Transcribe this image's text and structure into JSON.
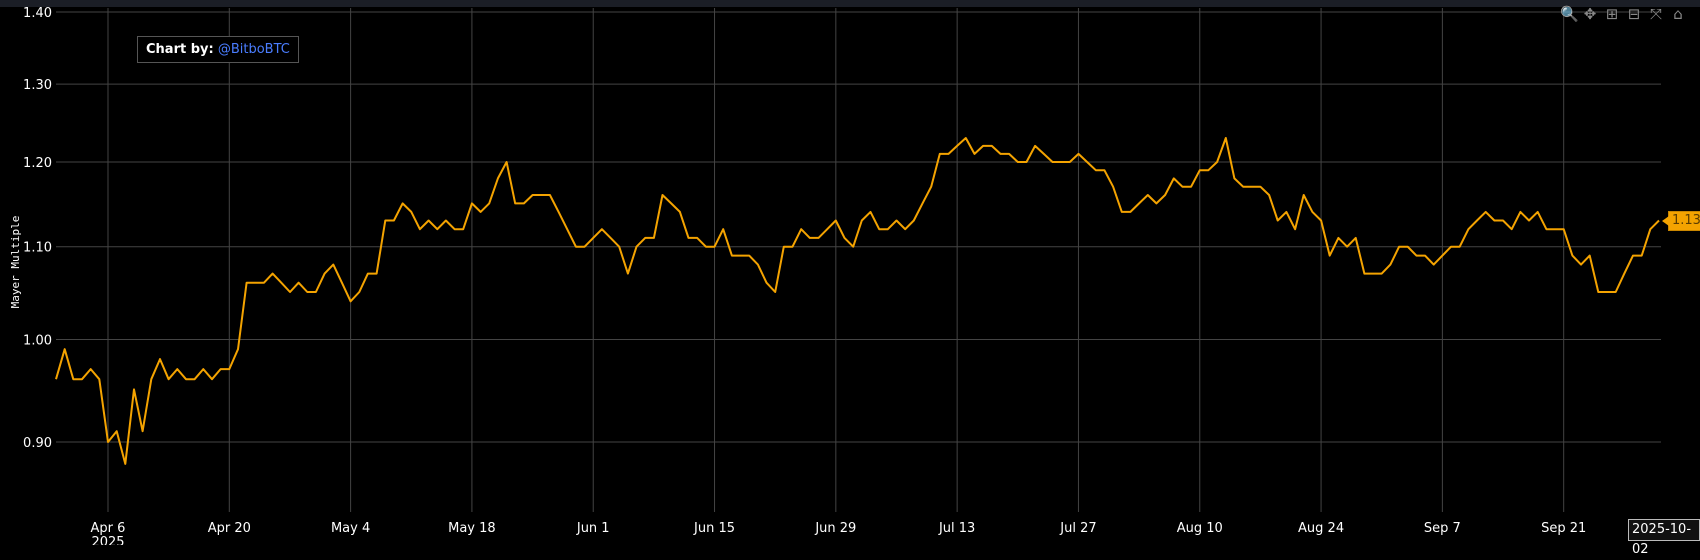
{
  "credit": {
    "label": "Chart by:",
    "handle": "@BitboBTC"
  },
  "modebar": [
    {
      "name": "zoom-icon",
      "glyph": "🔍"
    },
    {
      "name": "pan-icon",
      "glyph": "✥"
    },
    {
      "name": "zoom-in-icon",
      "glyph": "⊞"
    },
    {
      "name": "zoom-out-icon",
      "glyph": "⊟"
    },
    {
      "name": "autoscale-icon",
      "glyph": "⤧"
    },
    {
      "name": "reset-axes-icon",
      "glyph": "⌂"
    }
  ],
  "last_value_label": "1.13",
  "hover_date_label": "2025-10-02",
  "colors": {
    "line": "#f4a300",
    "grid": "#444444",
    "background": "#000000"
  },
  "chart_data": {
    "type": "line",
    "title": "",
    "xlabel": "",
    "ylabel": "Mayer Multiple",
    "y_scale": "log",
    "ylim": [
      0.855,
      1.4
    ],
    "yticks": [
      0.9,
      1.0,
      1.1,
      1.2,
      1.3,
      1.4
    ],
    "ytick_labels": [
      "0.90",
      "1.00",
      "1.10",
      "1.20",
      "1.30",
      "1.40"
    ],
    "x_start": "2025-03-31",
    "x_end": "2025-10-02",
    "x_step": "1 day",
    "xticks": [
      {
        "date": "2025-04-06",
        "label": "Apr 6",
        "sublabel": "2025"
      },
      {
        "date": "2025-04-20",
        "label": "Apr 20"
      },
      {
        "date": "2025-05-04",
        "label": "May 4"
      },
      {
        "date": "2025-05-18",
        "label": "May 18"
      },
      {
        "date": "2025-06-01",
        "label": "Jun 1"
      },
      {
        "date": "2025-06-15",
        "label": "Jun 15"
      },
      {
        "date": "2025-06-29",
        "label": "Jun 29"
      },
      {
        "date": "2025-07-13",
        "label": "Jul 13"
      },
      {
        "date": "2025-07-27",
        "label": "Jul 27"
      },
      {
        "date": "2025-08-10",
        "label": "Aug 10"
      },
      {
        "date": "2025-08-24",
        "label": "Aug 24"
      },
      {
        "date": "2025-09-07",
        "label": "Sep 7"
      },
      {
        "date": "2025-09-21",
        "label": "Sep 21"
      }
    ],
    "grid": true,
    "series": [
      {
        "name": "Mayer Multiple",
        "values": [
          0.96,
          0.99,
          0.96,
          0.96,
          0.97,
          0.96,
          0.9,
          0.91,
          0.88,
          0.95,
          0.91,
          0.96,
          0.98,
          0.96,
          0.97,
          0.96,
          0.96,
          0.97,
          0.96,
          0.97,
          0.97,
          0.99,
          1.06,
          1.06,
          1.06,
          1.07,
          1.06,
          1.05,
          1.06,
          1.05,
          1.05,
          1.07,
          1.08,
          1.06,
          1.04,
          1.05,
          1.07,
          1.07,
          1.13,
          1.13,
          1.15,
          1.14,
          1.12,
          1.13,
          1.12,
          1.13,
          1.12,
          1.12,
          1.15,
          1.14,
          1.15,
          1.18,
          1.2,
          1.15,
          1.15,
          1.16,
          1.16,
          1.16,
          1.14,
          1.12,
          1.1,
          1.1,
          1.11,
          1.12,
          1.11,
          1.1,
          1.07,
          1.1,
          1.11,
          1.11,
          1.16,
          1.15,
          1.14,
          1.11,
          1.11,
          1.1,
          1.1,
          1.12,
          1.09,
          1.09,
          1.09,
          1.08,
          1.06,
          1.05,
          1.1,
          1.1,
          1.12,
          1.11,
          1.11,
          1.12,
          1.13,
          1.11,
          1.1,
          1.13,
          1.14,
          1.12,
          1.12,
          1.13,
          1.12,
          1.13,
          1.15,
          1.17,
          1.21,
          1.21,
          1.22,
          1.23,
          1.21,
          1.22,
          1.22,
          1.21,
          1.21,
          1.2,
          1.2,
          1.22,
          1.21,
          1.2,
          1.2,
          1.2,
          1.21,
          1.2,
          1.19,
          1.19,
          1.17,
          1.14,
          1.14,
          1.15,
          1.16,
          1.15,
          1.16,
          1.18,
          1.17,
          1.17,
          1.19,
          1.19,
          1.2,
          1.23,
          1.18,
          1.17,
          1.17,
          1.17,
          1.16,
          1.13,
          1.14,
          1.12,
          1.16,
          1.14,
          1.13,
          1.09,
          1.11,
          1.1,
          1.11,
          1.07,
          1.07,
          1.07,
          1.08,
          1.1,
          1.1,
          1.09,
          1.09,
          1.08,
          1.09,
          1.1,
          1.1,
          1.12,
          1.13,
          1.14,
          1.13,
          1.13,
          1.12,
          1.14,
          1.13,
          1.14,
          1.12,
          1.12,
          1.12,
          1.09,
          1.08,
          1.09,
          1.05,
          1.05,
          1.05,
          1.07,
          1.09,
          1.09,
          1.12,
          1.13
        ]
      }
    ]
  }
}
